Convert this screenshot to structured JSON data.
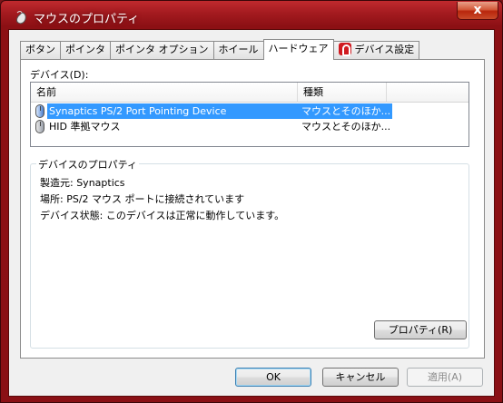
{
  "window": {
    "title": "マウスのプロパティ",
    "close_label": "x"
  },
  "tabs": [
    {
      "label": "ボタン"
    },
    {
      "label": "ポインタ"
    },
    {
      "label": "ポインタ オプション"
    },
    {
      "label": "ホイール"
    },
    {
      "label": "ハードウェア"
    },
    {
      "label": "デバイス設定"
    }
  ],
  "devices": {
    "label": "デバイス(D):",
    "columns": [
      "名前",
      "種類"
    ],
    "rows": [
      {
        "name": "Synaptics PS/2 Port Pointing Device",
        "type": "マウスとそのほか..."
      },
      {
        "name": "HID 準拠マウス",
        "type": "マウスとそのほか..."
      }
    ]
  },
  "properties": {
    "title": "デバイスのプロパティ",
    "manufacturer": "製造元: Synaptics",
    "location": "場所: PS/2 マウス ポートに接続されています",
    "status": "デバイス状態: このデバイスは正常に動作しています。",
    "button_label": "プロパティ(R)"
  },
  "footer": {
    "ok": "OK",
    "cancel": "キャンセル",
    "apply": "適用(A)"
  },
  "colors": {
    "titlebar": "#a31a1f",
    "selection": "#3399ff"
  }
}
